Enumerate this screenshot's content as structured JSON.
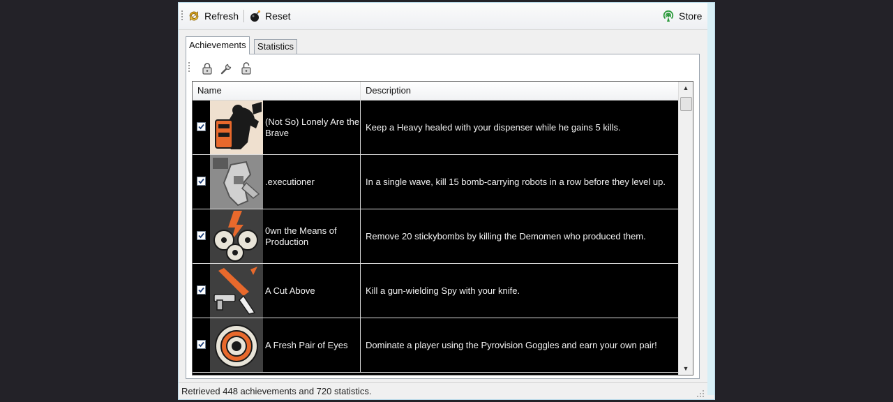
{
  "toolbar": {
    "refresh_label": "Refresh",
    "reset_label": "Reset",
    "store_label": "Store"
  },
  "tabs": [
    {
      "label": "Achievements",
      "active": true
    },
    {
      "label": "Statistics",
      "active": false
    }
  ],
  "inner_toolbar_icons": [
    "lock-icon",
    "wrench-icon",
    "unlock-icon"
  ],
  "columns": [
    "Name",
    "Description"
  ],
  "achievements": [
    {
      "checked": true,
      "name": "(Not So) Lonely Are the Brave",
      "description": "Keep a Heavy healed with your dispenser while he gains 5 kills.",
      "icon": "heavy-dispenser-icon"
    },
    {
      "checked": true,
      "name": ".executioner",
      "description": "In a single wave, kill 15 bomb-carrying robots in a row before they level up.",
      "icon": "executioner-15-icon"
    },
    {
      "checked": true,
      "name": "0wn the Means of Production",
      "description": "Remove 20 stickybombs by killing the Demomen who produced them.",
      "icon": "stickybombs-icon"
    },
    {
      "checked": true,
      "name": "A Cut Above",
      "description": "Kill a gun-wielding Spy with your knife.",
      "icon": "knife-gun-icon"
    },
    {
      "checked": true,
      "name": "A Fresh Pair of Eyes",
      "description": "Dominate a player using the Pyrovision Goggles and earn your own pair!",
      "icon": "eye-goggles-icon"
    }
  ],
  "status": "Retrieved 448 achievements and 720 statistics.",
  "colors": {
    "accent": "#e8692c",
    "list_background": "#000000",
    "window_background": "#f0f0f0"
  }
}
